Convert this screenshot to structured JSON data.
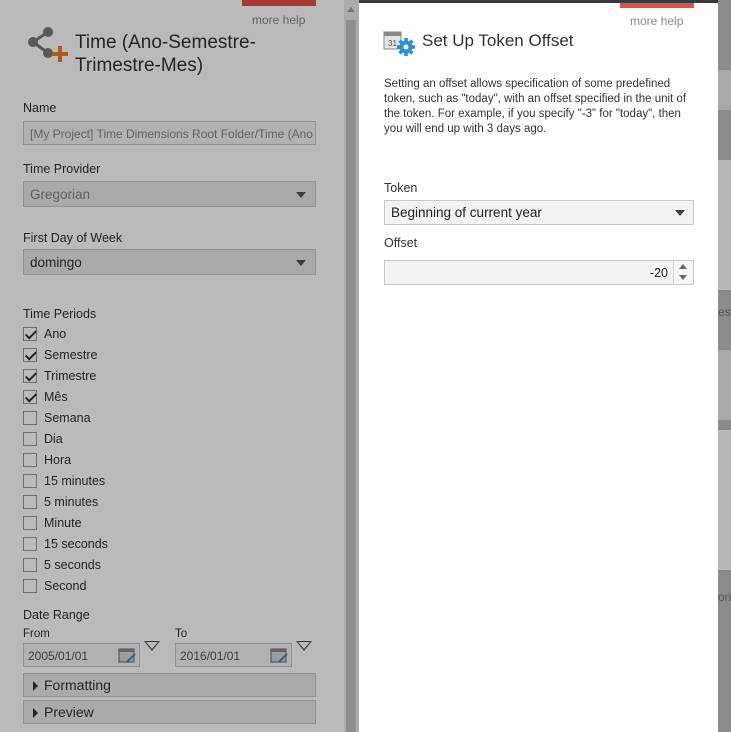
{
  "base_panel": {
    "more_help": "more help",
    "title": "Time (Ano-Semestre-Trimestre-Mes)",
    "name_label": "Name",
    "name_value": "[My Project] Time Dimensions Root Folder/Time (Ano",
    "time_provider_label": "Time Provider",
    "time_provider_value": "Gregorian",
    "first_day_label": "First Day of Week",
    "first_day_value": "domingo",
    "time_periods_label": "Time Periods",
    "time_periods": [
      {
        "label": "Ano",
        "checked": true
      },
      {
        "label": "Semestre",
        "checked": true
      },
      {
        "label": "Trimestre",
        "checked": true
      },
      {
        "label": "Mês",
        "checked": true
      },
      {
        "label": "Semana",
        "checked": false
      },
      {
        "label": "Dia",
        "checked": false
      },
      {
        "label": "Hora",
        "checked": false
      },
      {
        "label": "15 minutes",
        "checked": false
      },
      {
        "label": "5 minutes",
        "checked": false
      },
      {
        "label": "Minute",
        "checked": false
      },
      {
        "label": "15 seconds",
        "checked": false
      },
      {
        "label": "5 seconds",
        "checked": false
      },
      {
        "label": "Second",
        "checked": false
      }
    ],
    "date_range_label": "Date Range",
    "from_label": "From",
    "from_value": "2005/01/01",
    "to_label": "To",
    "to_value": "2016/01/01",
    "formatting_label": "Formatting",
    "preview_label": "Preview"
  },
  "background_app": {
    "fragment_1": "es",
    "fragment_2": "on"
  },
  "dialog": {
    "more_help": "more help",
    "title": "Set Up Token Offset",
    "icon_badge": "31",
    "description": "Setting an offset allows specification of some predefined token, such as \"today\", with an offset specified in the unit of the token. For example, if you specify \"-3\" for \"today\", then you will end up with 3 days ago.",
    "token_label": "Token",
    "token_value": "Beginning of current year",
    "offset_label": "Offset",
    "offset_value": "-20"
  },
  "colors": {
    "help_accent": "#e0504a",
    "gear_blue": "#2a8fd4",
    "plus_orange": "#e8821e"
  }
}
